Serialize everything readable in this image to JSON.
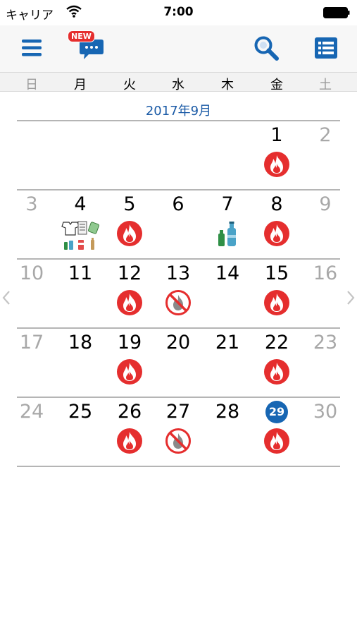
{
  "status": {
    "carrier": "キャリア",
    "time": "7:00"
  },
  "header": {
    "new_badge": "NEW",
    "icons": [
      "menu-icon",
      "chat-icon",
      "search-icon",
      "list-icon"
    ]
  },
  "weekdays": [
    "日",
    "月",
    "火",
    "水",
    "木",
    "金",
    "土"
  ],
  "month_title": "2017年9月",
  "colors": {
    "accent_blue": "#1766b3",
    "burnable_red": "#e52e2e",
    "muted_text": "#a8a8a8"
  },
  "weeks": [
    [
      null,
      null,
      null,
      null,
      null,
      {
        "d": "1",
        "icon": "burnable"
      },
      {
        "d": "2",
        "muted": true
      }
    ],
    [
      {
        "d": "3",
        "muted": true
      },
      {
        "d": "4",
        "icon": "resources"
      },
      {
        "d": "5",
        "icon": "burnable"
      },
      {
        "d": "6"
      },
      {
        "d": "7",
        "icon": "bottles"
      },
      {
        "d": "8",
        "icon": "burnable"
      },
      {
        "d": "9",
        "muted": true
      }
    ],
    [
      {
        "d": "10",
        "muted": true
      },
      {
        "d": "11"
      },
      {
        "d": "12",
        "icon": "burnable"
      },
      {
        "d": "13",
        "icon": "nonburnable"
      },
      {
        "d": "14"
      },
      {
        "d": "15",
        "icon": "burnable"
      },
      {
        "d": "16",
        "muted": true
      }
    ],
    [
      {
        "d": "17",
        "muted": true
      },
      {
        "d": "18"
      },
      {
        "d": "19",
        "icon": "burnable"
      },
      {
        "d": "20"
      },
      {
        "d": "21"
      },
      {
        "d": "22",
        "icon": "burnable"
      },
      {
        "d": "23",
        "muted": true
      }
    ],
    [
      {
        "d": "24",
        "muted": true
      },
      {
        "d": "25"
      },
      {
        "d": "26",
        "icon": "burnable"
      },
      {
        "d": "27",
        "icon": "nonburnable"
      },
      {
        "d": "28"
      },
      {
        "d": "29",
        "icon": "burnable",
        "today": true
      },
      {
        "d": "30",
        "muted": true
      }
    ]
  ]
}
